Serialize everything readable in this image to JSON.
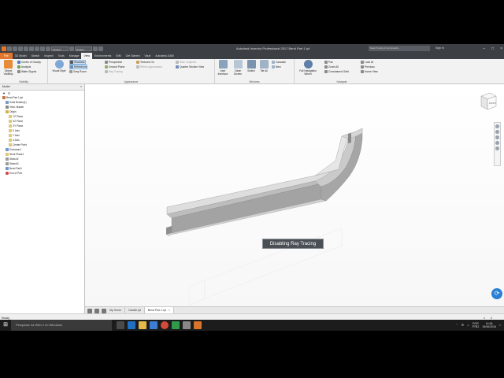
{
  "title_bar": {
    "quick_access_dropdowns": [
      "Generic",
      "Default"
    ],
    "app_title": "Autodesk Inventor Professional 2017   Bend Part 1.ipt",
    "search_placeholder": "Search Help & Commands...",
    "sign_in": "Sign In"
  },
  "ribbon_tabs": [
    "File",
    "3D Model",
    "Sketch",
    "Inspect",
    "Tools",
    "Manage",
    "View",
    "Environments",
    "BIM",
    "Get Started",
    "Vault",
    "Autodesk A360"
  ],
  "active_tab": "View",
  "ribbon": {
    "visibility": {
      "title": "Visibility",
      "object_visibility": "Object Visibility",
      "center_of_gravity": "Center of Gravity",
      "analysis": "Analysis",
      "iMate_glyphs": "iMate Glyphs"
    },
    "appearance": {
      "title": "Appearance",
      "visual_style": "Visual Style",
      "shadows": "Shadows",
      "reflections": "Reflections",
      "gray_room": "Gray Room",
      "perspective": "Perspective",
      "ground_plane": "Ground Plane",
      "ray_tracing": "Ray Tracing",
      "textures_on": "Textures On",
      "refine_appearance": "Refine Appearance",
      "slice_graphics": "Slice Graphics",
      "quarter_section_view": "Quarter Section View"
    },
    "windows": {
      "title": "Windows",
      "user_interface": "User Interface",
      "clean_screen": "Clean Screen",
      "switch": "Switch",
      "tile_all": "Tile All",
      "cascade": "Cascade",
      "new": "New"
    },
    "navigate": {
      "title": "Navigate",
      "full_navigation_wheel": "Full Navigation Wheel",
      "pan": "Pan",
      "zoom_all": "Zoom All",
      "constrained_orbit": "Constrained Orbit",
      "look_at": "Look At",
      "previous": "Previous",
      "home_view": "Home View"
    }
  },
  "browser": {
    "header": "Model",
    "items": [
      {
        "label": "Bend Part 1.ipt",
        "depth": 0
      },
      {
        "label": "Solid Bodies(1)",
        "depth": 1
      },
      {
        "label": "View: Master",
        "depth": 1
      },
      {
        "label": "Origin",
        "depth": 1
      },
      {
        "label": "YZ Plane",
        "depth": 2
      },
      {
        "label": "XZ Plane",
        "depth": 2
      },
      {
        "label": "XY Plane",
        "depth": 2
      },
      {
        "label": "X Axis",
        "depth": 2
      },
      {
        "label": "Y Axis",
        "depth": 2
      },
      {
        "label": "Z Axis",
        "depth": 2
      },
      {
        "label": "Center Point",
        "depth": 2
      },
      {
        "label": "Extrusion1",
        "depth": 1
      },
      {
        "label": "Work Plane1",
        "depth": 1
      },
      {
        "label": "Sketch2",
        "depth": 1
      },
      {
        "label": "Sketch3",
        "depth": 1
      },
      {
        "label": "Bend Part1",
        "depth": 1
      },
      {
        "label": "End of Part",
        "depth": 1
      }
    ]
  },
  "viewport": {
    "tooltip": "Disabling Ray Tracing",
    "viewcube_label": "FRONT"
  },
  "document_tabs": [
    "My Home",
    "Candle.ipt",
    "Bend Part 1.ipt"
  ],
  "active_document": "Bend Part 1.ipt",
  "status_bar": {
    "status": "Ready",
    "numbers": [
      "1",
      "2"
    ]
  },
  "taskbar": {
    "search_placeholder": "Pesquisar na Web e no Windows",
    "language": "POR",
    "layout": "PTB2",
    "time": "14:06",
    "date": "15/06/2016"
  },
  "colors": {
    "file_tab": "#e2762c",
    "title_bar": "#3c3f44",
    "ribbon": "#f2f2f2",
    "fab": "#2a7fd4",
    "tooltip": "#4a4f55"
  }
}
